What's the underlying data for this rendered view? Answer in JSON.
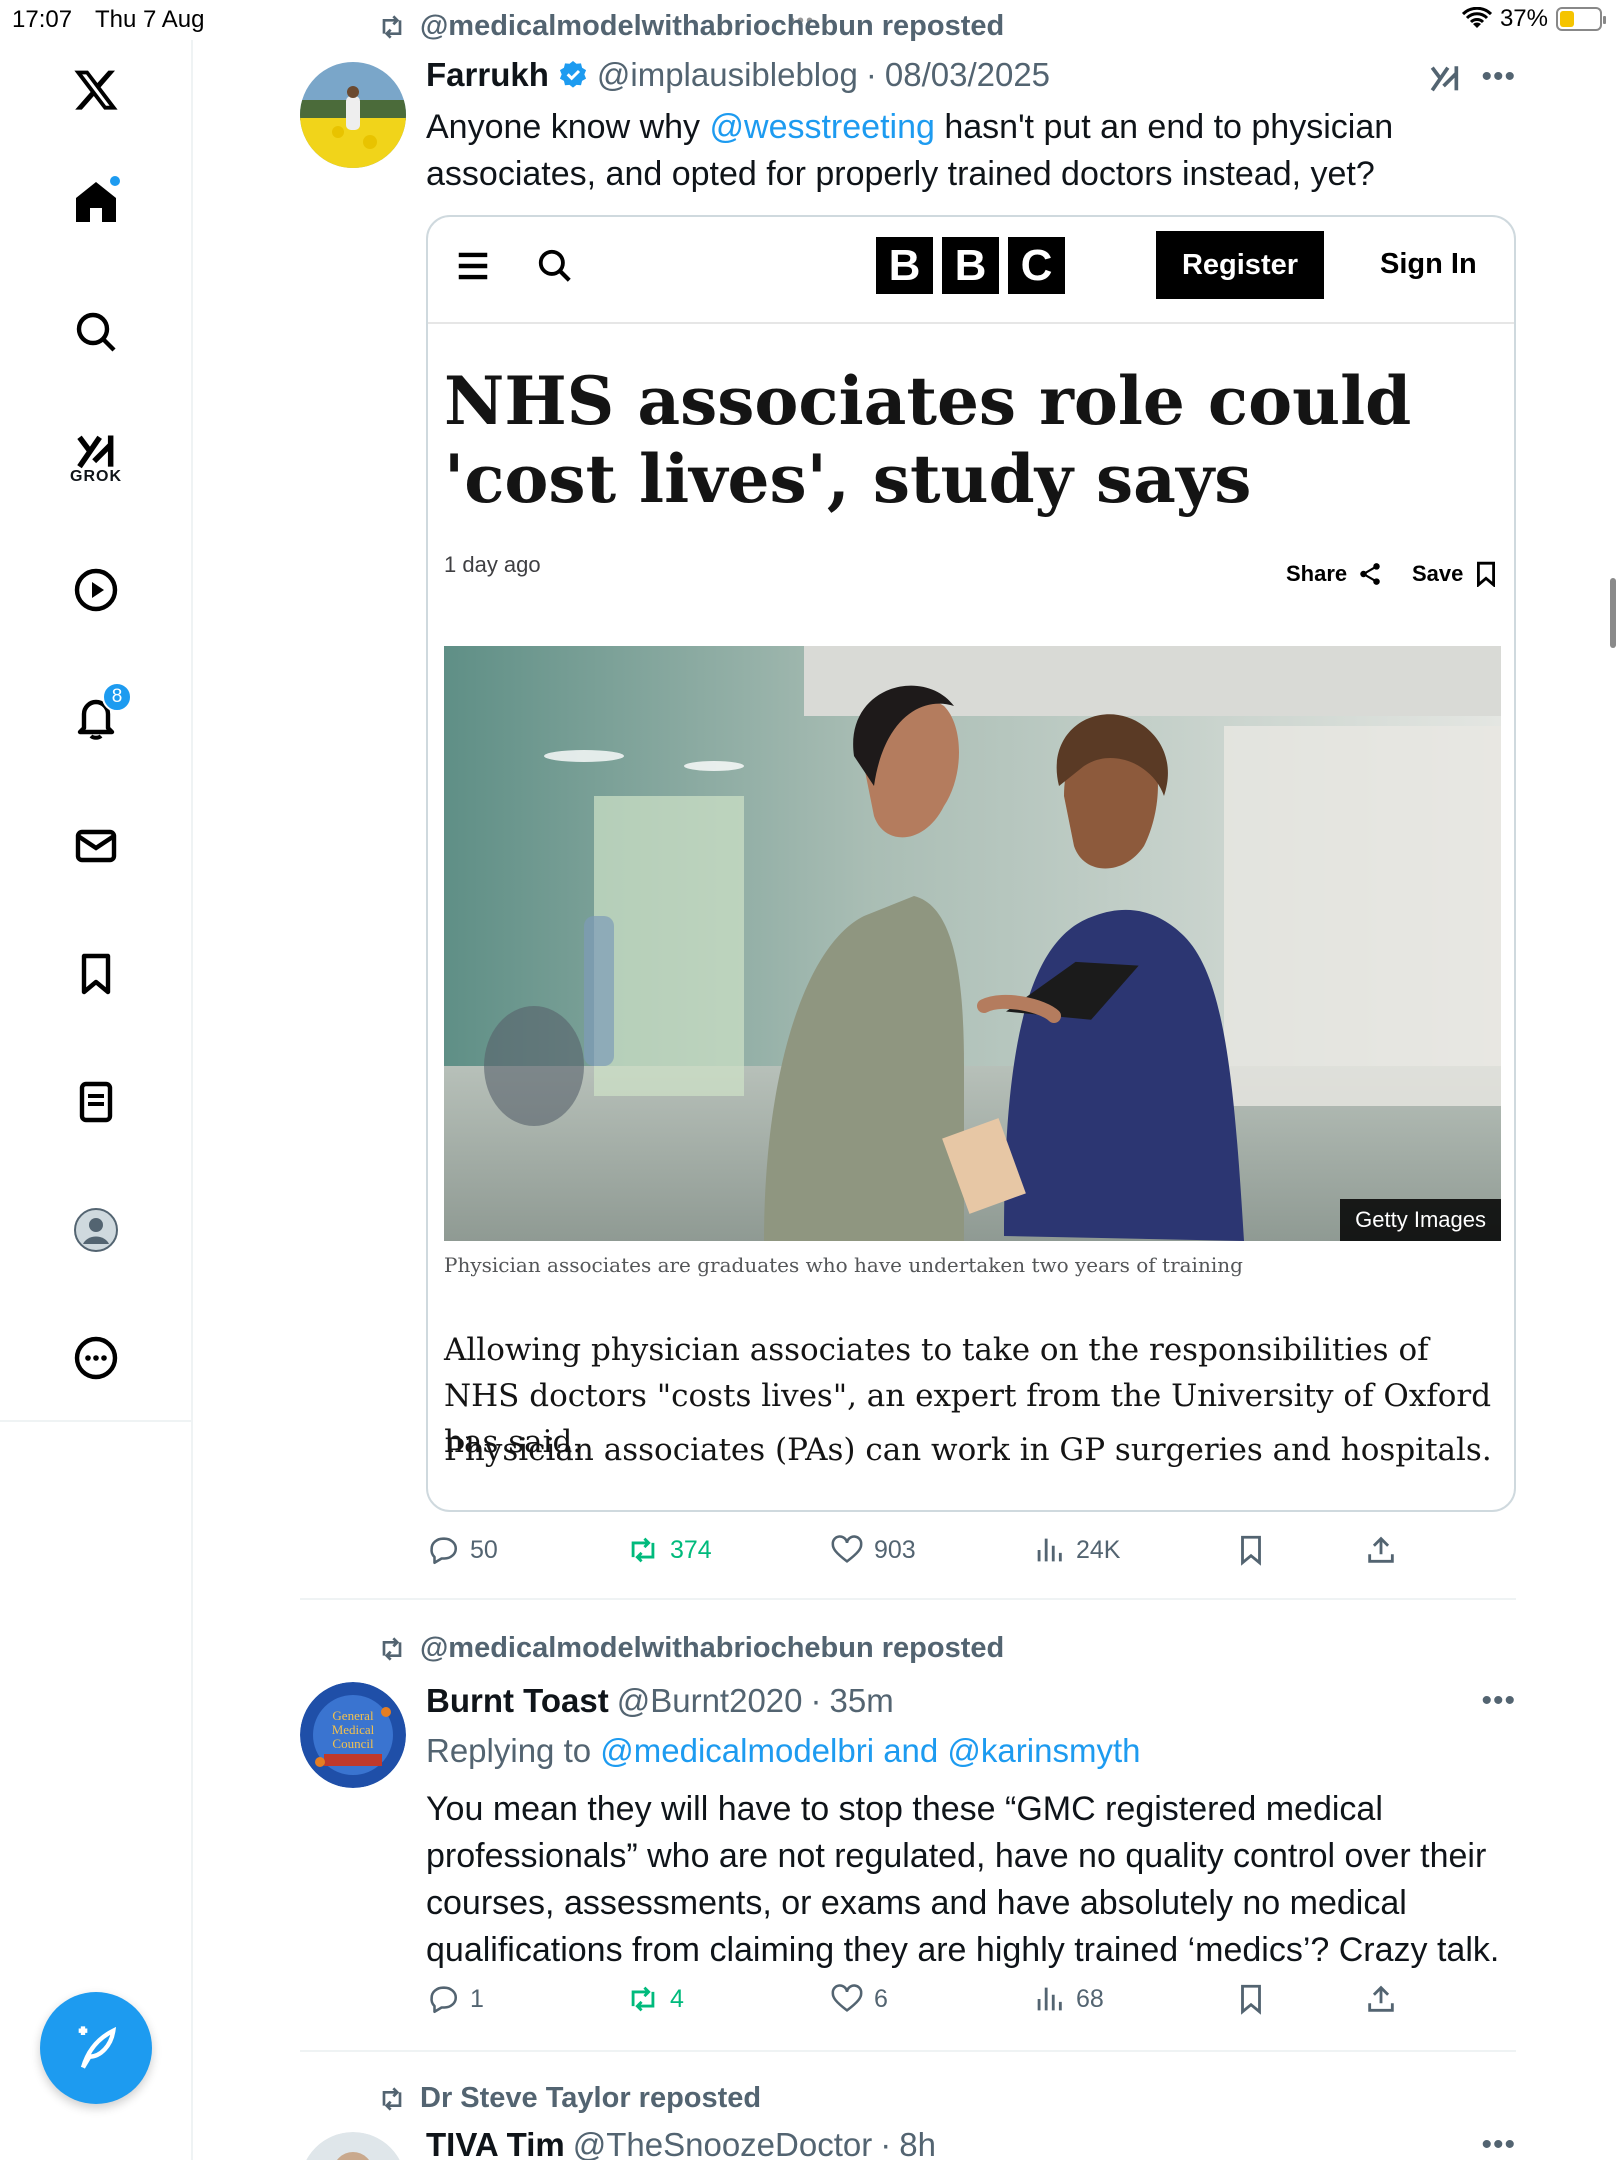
{
  "status_bar": {
    "time": "17:07",
    "date": "Thu 7 Aug",
    "battery": "37%",
    "battery_level": 0.37,
    "battery_color": "#f5c400"
  },
  "sidebar": {
    "notifications_count": "8",
    "grok_label": "GROK",
    "items": [
      "x-logo",
      "home",
      "explore",
      "grok",
      "video",
      "notifications",
      "messages",
      "bookmarks",
      "lists",
      "profile",
      "more"
    ]
  },
  "accent": "#1d9bf0",
  "posts": [
    {
      "reposted_by": "@medicalmodelwithabriochebun reposted",
      "name": "Farrukh",
      "verified": true,
      "handle": "@implausibleblog",
      "sep": "·",
      "time": "08/03/2025",
      "text_before": "Anyone know why ",
      "mention": "@wesstreeting",
      "text_after": " hasn't put an end to physician associates, and opted for properly trained doctors instead, yet?",
      "card": {
        "logo": [
          "B",
          "B",
          "C"
        ],
        "register": "Register",
        "sign_in": "Sign In",
        "headline": "NHS associates role could 'cost lives', study says",
        "time": "1 day ago",
        "share": "Share",
        "save": "Save",
        "image_credit": "Getty Images",
        "caption": "Physician associates are graduates who have undertaken two years of training",
        "para1": "Allowing physician associates to take on the responsibilities of NHS doctors \"costs lives\", an expert from the University of Oxford has said.",
        "para2": "Physician associates (PAs) can work in GP surgeries and hospitals."
      },
      "actions": {
        "replies": "50",
        "reposts": "374",
        "likes": "903",
        "views": "24K"
      }
    },
    {
      "reposted_by": "@medicalmodelwithabriochebun reposted",
      "name": "Burnt Toast",
      "handle": "@Burnt2020",
      "sep": "·",
      "time": "35m",
      "replying_label": "Replying to ",
      "replying_to": "@medicalmodelbri and @karinsmyth",
      "avatar_text": "General Medical Council",
      "text": "You mean they will have to stop these “GMC registered medical professionals” who are not regulated, have no quality control over their courses, assessments, or exams and have absolutely no medical qualifications from claiming they are highly trained ‘medics’? Crazy talk.",
      "actions": {
        "replies": "1",
        "reposts": "4",
        "likes": "6",
        "views": "68"
      }
    },
    {
      "reposted_by": "Dr Steve Taylor reposted",
      "name": "TIVA Tim",
      "handle": "@TheSnoozeDoctor",
      "sep": "·",
      "time": "8h"
    }
  ]
}
